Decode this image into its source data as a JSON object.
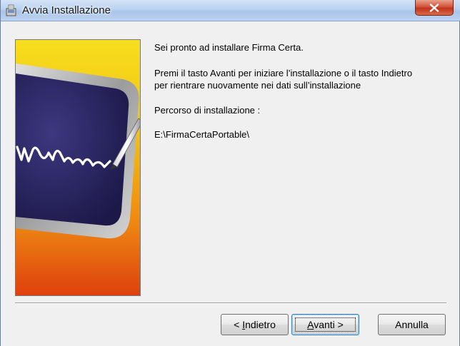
{
  "window": {
    "title": "Avvia Installazione"
  },
  "content": {
    "line1": "Sei pronto ad installare Firma Certa.",
    "line2a": "Premi il tasto Avanti per iniziare l’installazione o il tasto Indietro",
    "line2b": "per rientrare nuovamente nei dati sull’installazione",
    "path_label": "Percorso di installazione :",
    "path_value": "E:\\FirmaCertaPortable\\"
  },
  "buttons": {
    "back_prefix": "< ",
    "back_accel": "I",
    "back_rest": "ndietro",
    "next_accel": "A",
    "next_rest": "vanti >",
    "cancel_label": "Annulla"
  },
  "icons": {
    "app": "installer-icon",
    "close": "close-icon"
  },
  "colors": {
    "close_button": "#c7401f",
    "image_top": "#f3d21a",
    "image_bottom": "#e04a10",
    "tablet": "#2a2560"
  }
}
